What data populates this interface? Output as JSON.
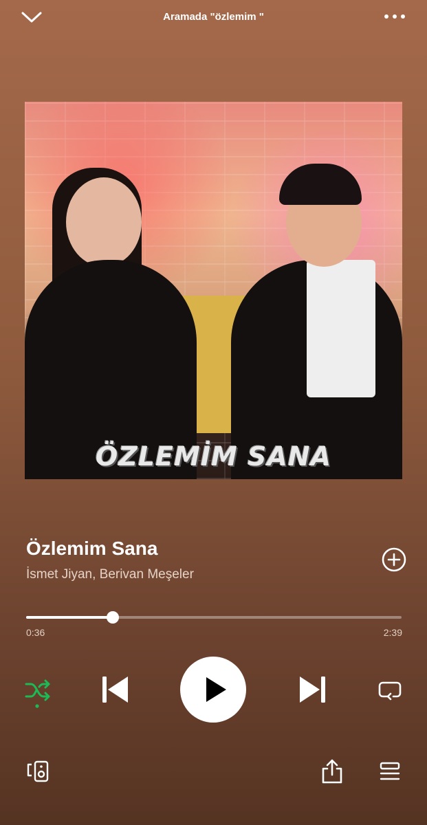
{
  "header": {
    "context_title": "Aramada \"özlemim \"",
    "collapse_icon": "chevron-down-icon",
    "more_icon": "more-horizontal-icon"
  },
  "cover": {
    "caption": "ÖZLEMİM  SANA"
  },
  "track": {
    "title": "Özlemim Sana",
    "artists": "İsmet Jiyan, Berivan Meşeler",
    "add_icon": "add-circle-icon"
  },
  "playback": {
    "elapsed": "0:36",
    "total": "2:39",
    "progress_fraction": 0.23,
    "shuffle_active": true,
    "is_playing": false
  },
  "controls": {
    "shuffle_icon": "shuffle-icon",
    "previous_icon": "skip-previous-icon",
    "play_icon": "play-icon",
    "next_icon": "skip-next-icon",
    "repeat_icon": "repeat-icon"
  },
  "footer": {
    "devices_icon": "devices-icon",
    "share_icon": "share-icon",
    "queue_icon": "queue-icon"
  },
  "colors": {
    "accent_green": "#1db954",
    "background_top": "#a4694a",
    "background_bottom": "#553322"
  }
}
